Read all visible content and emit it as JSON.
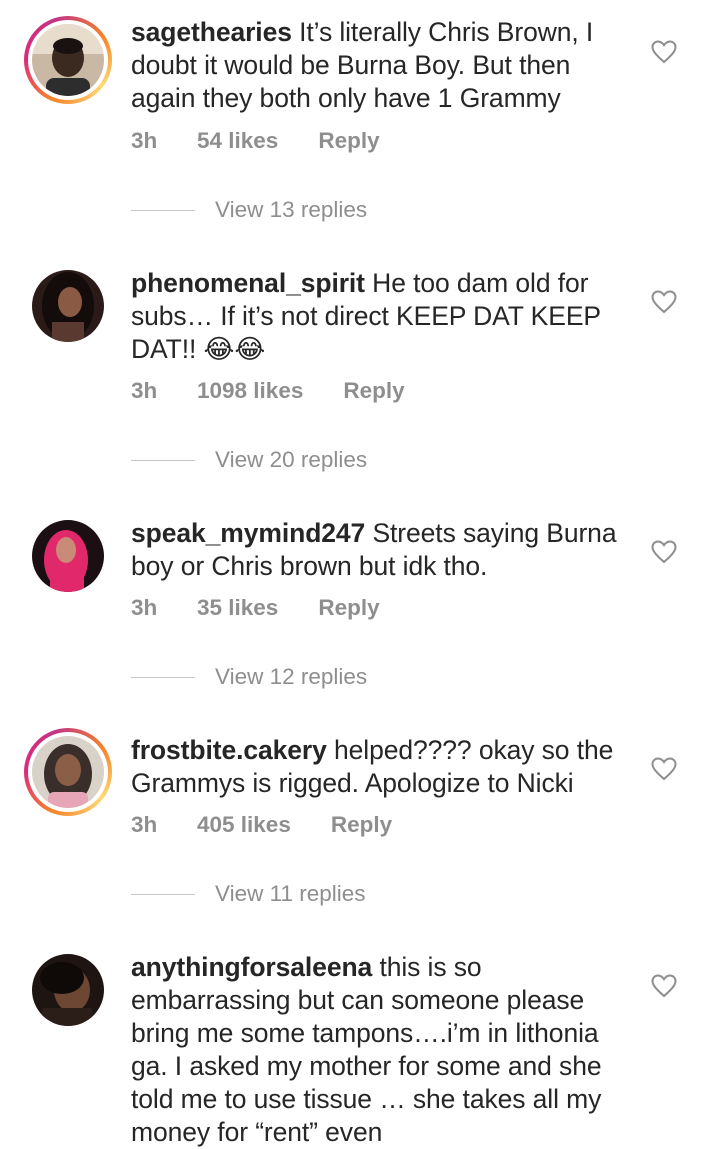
{
  "comments": [
    {
      "username": "sagethearies",
      "text": " It’s literally Chris Brown, I doubt it would be Burna Boy. But then again they both only have 1 Grammy",
      "time": "3h",
      "likes": "54 likes",
      "reply_label": "Reply",
      "view_replies": "View 13 replies",
      "has_story_ring": true
    },
    {
      "username": "phenomenal_spirit",
      "text": " He too dam old for subs… If it’s not direct KEEP DAT KEEP DAT!! 😂😂",
      "time": "3h",
      "likes": "1098 likes",
      "reply_label": "Reply",
      "view_replies": "View 20 replies",
      "has_story_ring": false
    },
    {
      "username": "speak_mymind247",
      "text": " Streets saying Burna boy or Chris brown but idk tho.",
      "time": "3h",
      "likes": "35 likes",
      "reply_label": "Reply",
      "view_replies": "View 12 replies",
      "has_story_ring": false
    },
    {
      "username": "frostbite.cakery",
      "text": " helped???? okay so the Grammys is rigged. Apologize to Nicki",
      "time": "3h",
      "likes": "405 likes",
      "reply_label": "Reply",
      "view_replies": "View 11 replies",
      "has_story_ring": true
    },
    {
      "username": "anythingforsaleena",
      "text": " this is so embarrassing but can someone please bring me some tampons….i’m in lithonia ga. I asked my mother for some and she told me to use tissue … she takes all my money for “rent” even",
      "has_story_ring": false
    }
  ],
  "icons": {
    "like": "heart-outline-icon"
  },
  "colors": {
    "text": "#262626",
    "secondary": "#8e8e8e"
  }
}
